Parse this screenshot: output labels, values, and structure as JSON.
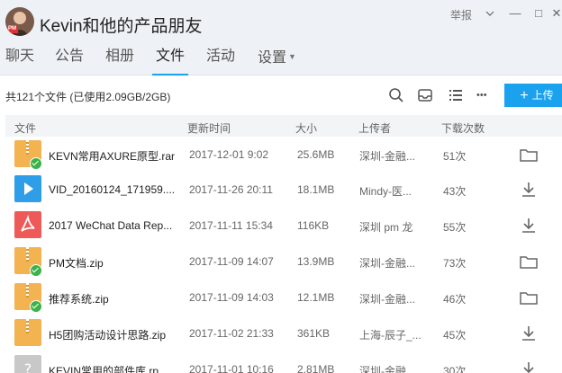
{
  "window": {
    "title": "Kevin和他的产品朋友",
    "avatar_badge": "PM",
    "report_label": "举报",
    "minimize_glyph": "—",
    "maximize_glyph": "□",
    "close_glyph": "✕"
  },
  "tabs": [
    {
      "label": "聊天",
      "active": false
    },
    {
      "label": "公告",
      "active": false
    },
    {
      "label": "相册",
      "active": false
    },
    {
      "label": "文件",
      "active": true
    },
    {
      "label": "活动",
      "active": false
    },
    {
      "label": "设置",
      "active": false
    }
  ],
  "toolbar": {
    "summary": "共121个文件 (已使用2.09GB/2GB)",
    "upload_label": "上传",
    "more_glyph": "•••"
  },
  "columns": {
    "name": "文件",
    "date": "更新时间",
    "size": "大小",
    "uploader": "上传者",
    "downloads": "下载次数"
  },
  "files": [
    {
      "name": "KEVN常用AXURE原型.rar",
      "date": "2017-12-01 9:02",
      "size": "25.6MB",
      "uploader": "深圳-金融...",
      "downloads": "51次",
      "type": "rar",
      "downloaded": true,
      "action": "folder-icon"
    },
    {
      "name": "VID_20160124_171959....",
      "date": "2017-11-26 20:11",
      "size": "18.1MB",
      "uploader": "Mindy-医...",
      "downloads": "43次",
      "type": "video",
      "downloaded": false,
      "action": "download-icon"
    },
    {
      "name": "2017 WeChat Data Rep...",
      "date": "2017-11-11 15:34",
      "size": "116KB",
      "uploader": "深圳 pm 龙",
      "downloads": "55次",
      "type": "pdf",
      "downloaded": false,
      "action": "download-icon"
    },
    {
      "name": "PM文档.zip",
      "date": "2017-11-09 14:07",
      "size": "13.9MB",
      "uploader": "深圳-金融...",
      "downloads": "73次",
      "type": "zip",
      "downloaded": true,
      "action": "folder-icon"
    },
    {
      "name": "推荐系统.zip",
      "date": "2017-11-09 14:03",
      "size": "12.1MB",
      "uploader": "深圳-金融...",
      "downloads": "46次",
      "type": "zip",
      "downloaded": true,
      "action": "folder-icon"
    },
    {
      "name": "H5团购活动设计思路.zip",
      "date": "2017-11-02 21:33",
      "size": "361KB",
      "uploader": "上海-辰子_...",
      "downloads": "45次",
      "type": "zip",
      "downloaded": false,
      "action": "download-icon"
    },
    {
      "name": "KEVIN常用的部件库.rp",
      "date": "2017-11-01 10:16",
      "size": "2.81MB",
      "uploader": "深圳-金融...",
      "downloads": "30次",
      "type": "unknown",
      "downloaded": false,
      "action": "download-icon"
    }
  ],
  "colors": {
    "accent": "#1aa2ef",
    "header_bg": "#eef2f6",
    "archive": "#f4b351",
    "video": "#2e9ee8",
    "pdf": "#ee5a58",
    "check": "#3bb34a"
  }
}
